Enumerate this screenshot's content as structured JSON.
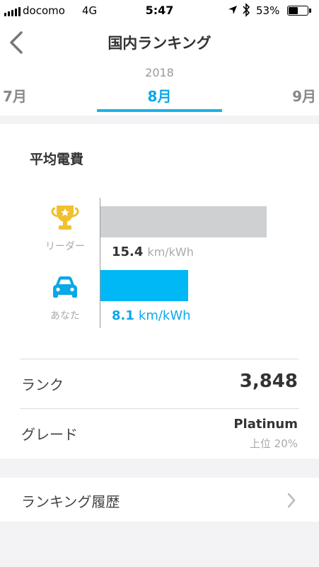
{
  "status_bar": {
    "carrier": "docomo",
    "network": "4G",
    "time": "5:47",
    "battery_text": "53%",
    "battery_level": 0.53
  },
  "nav": {
    "title": "国内ランキング"
  },
  "period": {
    "year": "2018",
    "prev_month": "7月",
    "current_month": "8月",
    "next_month": "9月"
  },
  "efficiency": {
    "title": "平均電費",
    "leader": {
      "label": "リーダー",
      "value": "15.4",
      "unit": "km/kWh"
    },
    "you": {
      "label": "あなた",
      "value": "8.1",
      "unit": "km/kWh"
    },
    "bar_max": 16.2
  },
  "rank": {
    "label": "ランク",
    "value": "3,848"
  },
  "grade": {
    "label": "グレード",
    "value": "Platinum",
    "percentile": "上位 20%"
  },
  "history": {
    "label": "ランキング履歴"
  },
  "colors": {
    "accent": "#0aa8e8",
    "bar_you": "#00b8f5",
    "bar_leader": "#cfd0d2",
    "trophy": "#f0c030"
  }
}
